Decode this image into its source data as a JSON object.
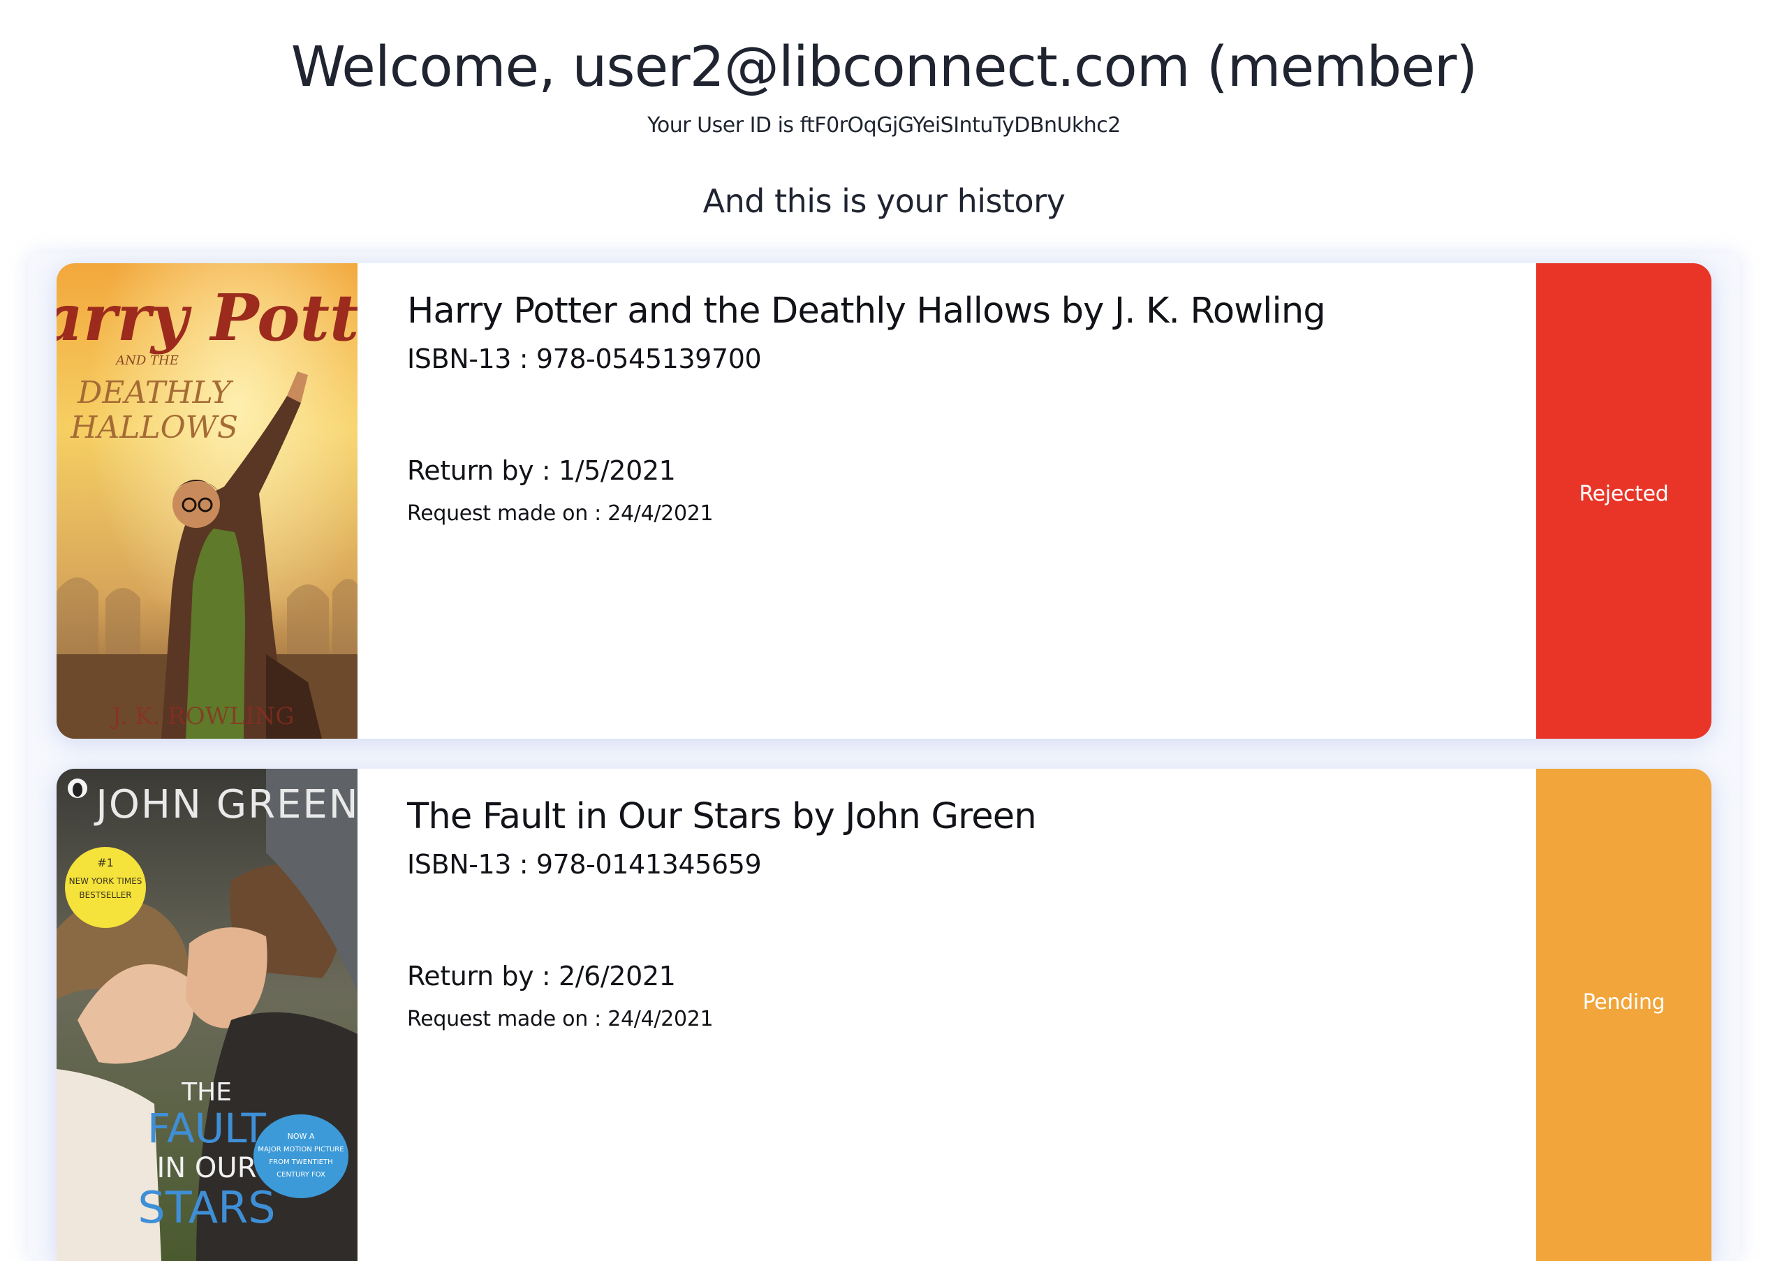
{
  "header": {
    "welcome": "Welcome, user2@libconnect.com (member)",
    "user_id_line": "Your User ID is ftF0rOqGjGYeiSIntuTyDBnUkhc2",
    "history_heading": "And this is your history"
  },
  "history": [
    {
      "title": "Harry Potter and the Deathly Hallows by J. K. Rowling",
      "isbn": "ISBN-13 : 978-0545139700",
      "return_by": "Return by : 1/5/2021",
      "requested_on": "Request made on : 24/4/2021",
      "status": "Rejected",
      "status_color": "#e83527",
      "cover": {
        "title_line1": "Harry Potter",
        "subtitle_and_the": "AND THE",
        "subtitle_deathly": "DEATHLY",
        "subtitle_hallows": "HALLOWS",
        "author": "J. K. ROWLING"
      }
    },
    {
      "title": "The Fault in Our Stars by John Green",
      "isbn": "ISBN-13 : 978-0141345659",
      "return_by": "Return by : 2/6/2021",
      "requested_on": "Request made on : 24/4/2021",
      "status": "Pending",
      "status_color": "#f1a53a",
      "cover": {
        "author": "JOHN GREEN",
        "badge_line1": "#1",
        "badge_line2": "NEW YORK TIMES",
        "badge_line3": "BESTSELLER",
        "title_the": "THE",
        "title_fault": "FAULT",
        "title_in_our": "IN OUR",
        "title_stars": "STARS",
        "tag_line1": "NOW A",
        "tag_line2": "MAJOR MOTION PICTURE",
        "tag_line3": "FROM TWENTIETH",
        "tag_line4": "CENTURY FOX"
      }
    }
  ]
}
